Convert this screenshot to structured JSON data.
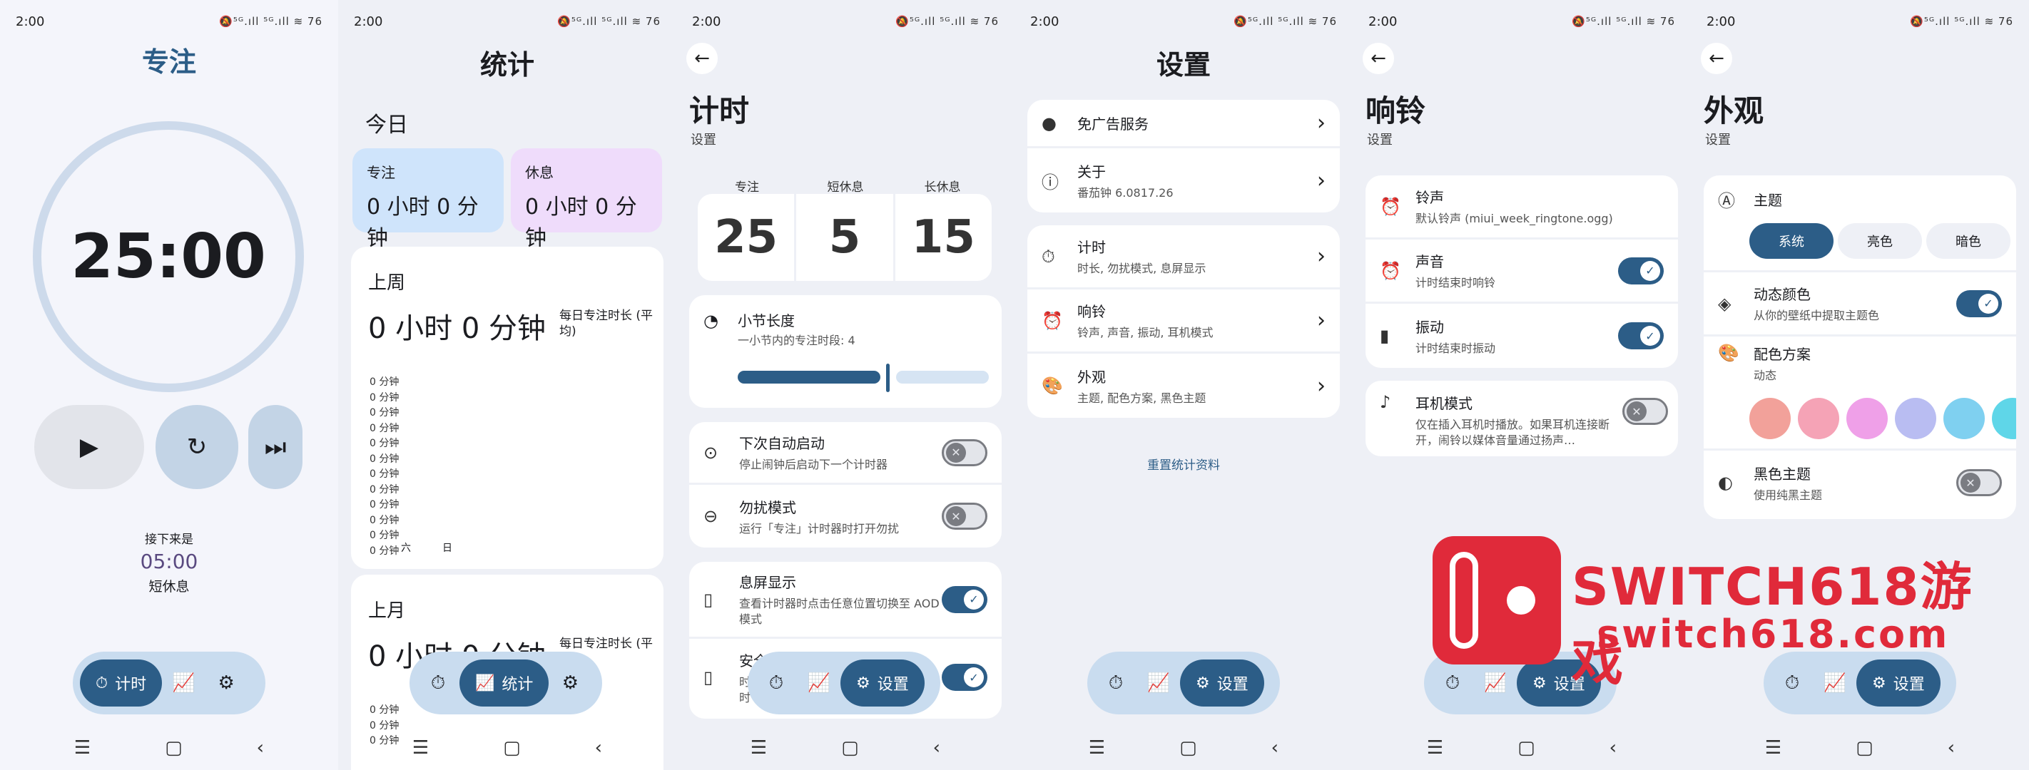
{
  "status": {
    "time": "2:00",
    "icons": "🔕⁵ᴳ.ıll ⁵ᴳ.ıll ≋ 76"
  },
  "nav": {
    "timer": "计时",
    "stats": "统计",
    "settings": "设置"
  },
  "screen1": {
    "title": "专注",
    "timer": "25:00",
    "next_label": "接下来是",
    "next_time": "05:00",
    "next_type": "短休息"
  },
  "screen2": {
    "title": "统计",
    "today": "今日",
    "focus_label": "专注",
    "focus_value": "0 小时 0 分钟",
    "rest_label": "休息",
    "rest_value": "0 小时 0 分钟",
    "last_week": "上周",
    "last_week_value": "0 小时 0 分钟",
    "daily_avg": "每日专注时长 (平均)",
    "y_labels": [
      "0 分钟",
      "0 分钟",
      "0 分钟",
      "0 分钟",
      "0 分钟",
      "0 分钟",
      "0 分钟",
      "0 分钟",
      "0 分钟",
      "0 分钟",
      "0 分钟",
      "0 分钟"
    ],
    "x_labels": [
      "六",
      "日"
    ],
    "last_month": "上月",
    "last_month_value": "0 小时 0 分钟",
    "daily_avg2": "每日专注时长 (平",
    "month_y": [
      "0 分钟",
      "0 分钟",
      "0 分钟"
    ]
  },
  "screen3": {
    "title": "计时",
    "subtitle": "设置",
    "focus": "专注",
    "short": "短休息",
    "long": "长休息",
    "focus_val": "25",
    "short_val": "5",
    "long_val": "15",
    "session_title": "小节长度",
    "session_sub": "一小节内的专注时段: 4",
    "auto_title": "下次自动启动",
    "auto_sub": "停止闹钟后启动下一个计时器",
    "dnd_title": "勿扰模式",
    "dnd_sub": "运行「专注」计时器时打开勿扰",
    "aod_title": "息屏显示",
    "aod_sub": "查看计时器时点击任意位置切换至 AOD 模式",
    "safe_title": "安全",
    "safe_sub1": "时",
    "safe_sub2": "时"
  },
  "screen4": {
    "title": "设置",
    "adfree": "免广告服务",
    "about": "关于",
    "version": "番茄钟 6.0817.26",
    "timer": "计时",
    "timer_sub": "时长, 勿扰模式, 息屏显示",
    "ring": "响铃",
    "ring_sub": "铃声, 声音, 振动, 耳机模式",
    "look": "外观",
    "look_sub": "主题, 配色方案, 黑色主题",
    "reset": "重置统计资料"
  },
  "screen5": {
    "title": "响铃",
    "subtitle": "设置",
    "tone": "铃声",
    "tone_sub": "默认铃声 (miui_week_ringtone.ogg)",
    "sound": "声音",
    "sound_sub": "计时结束时响铃",
    "vib": "振动",
    "vib_sub": "计时结束时振动",
    "ear": "耳机模式",
    "ear_sub": "仅在插入耳机时播放。如果耳机连接断开，闹铃以媒体音量通过扬声…"
  },
  "screen6": {
    "title": "外观",
    "subtitle": "设置",
    "theme": "主题",
    "sys": "系统",
    "light": "亮色",
    "dark": "暗色",
    "dyn": "动态颜色",
    "dyn_sub": "从你的壁纸中提取主题色",
    "scheme": "配色方案",
    "scheme_sub": "动态",
    "black": "黑色主题",
    "black_sub": "使用纯黑主题",
    "swatches": [
      "#f2a19a",
      "#f5a3b6",
      "#efa0e8",
      "#b9bdf2",
      "#7fd0f0",
      "#5fd6e8"
    ]
  },
  "watermark": {
    "top": "SWITCH618游戏",
    "bottom": "switch618.com"
  },
  "colors": {
    "accent": "#2c5d87",
    "pill": "#c9dcef",
    "focus_tile": "#cfe4fb",
    "rest_tile": "#efdcfb"
  }
}
